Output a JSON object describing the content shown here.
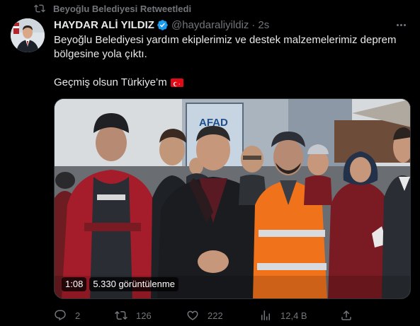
{
  "retweet_context": {
    "text": "Beyoğlu Belediyesi Retweetledi"
  },
  "author": {
    "name": "HAYDAR ALİ YILDIZ",
    "handle": "@haydaraliyildiz",
    "separator": "·",
    "time": "2s"
  },
  "tweet": {
    "paragraph1": "Beyoğlu Belediyesi yardım ekiplerimiz ve destek malzemelerimiz deprem bölgesine yola çıktı.",
    "paragraph2": "Geçmiş olsun Türkiye’m"
  },
  "media": {
    "sign_text": "AFAD",
    "duration": "1:08",
    "views": "5.330 görüntülenme"
  },
  "actions": {
    "replies": "2",
    "retweets": "126",
    "likes": "222",
    "views": "12,4 B"
  },
  "colors": {
    "background": "#000000",
    "text": "#e7e9ea",
    "muted": "#71767b",
    "verified": "#1d9bf0"
  }
}
